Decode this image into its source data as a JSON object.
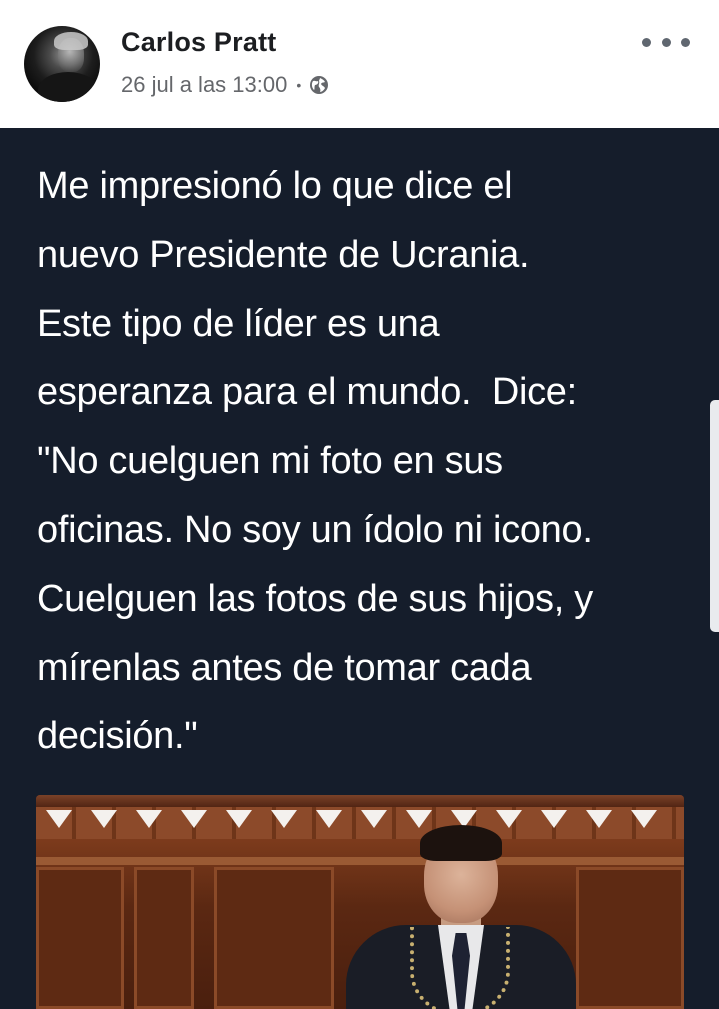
{
  "post": {
    "author_name": "Carlos Pratt",
    "timestamp": "26 jul a las 13:00",
    "separator": "•",
    "privacy_icon": "globe-icon",
    "more_icon": "ellipsis-icon",
    "text": "Me impresionó lo que dice el\nnuevo Presidente de Ucrania.\nEste tipo de líder es una\nesperanza para el mundo.  Dice:\n\"No cuelguen mi foto en sus\noficinas. No soy un ídolo ni icono.\nCuelguen las fotos de sus hijos, y\nmírenlas antes de tomar cada\ndecisión.\""
  },
  "colors": {
    "content_background": "#151d2b",
    "post_text": "#ffffff",
    "author_name": "#1c1e21",
    "meta_text": "#65676b"
  }
}
